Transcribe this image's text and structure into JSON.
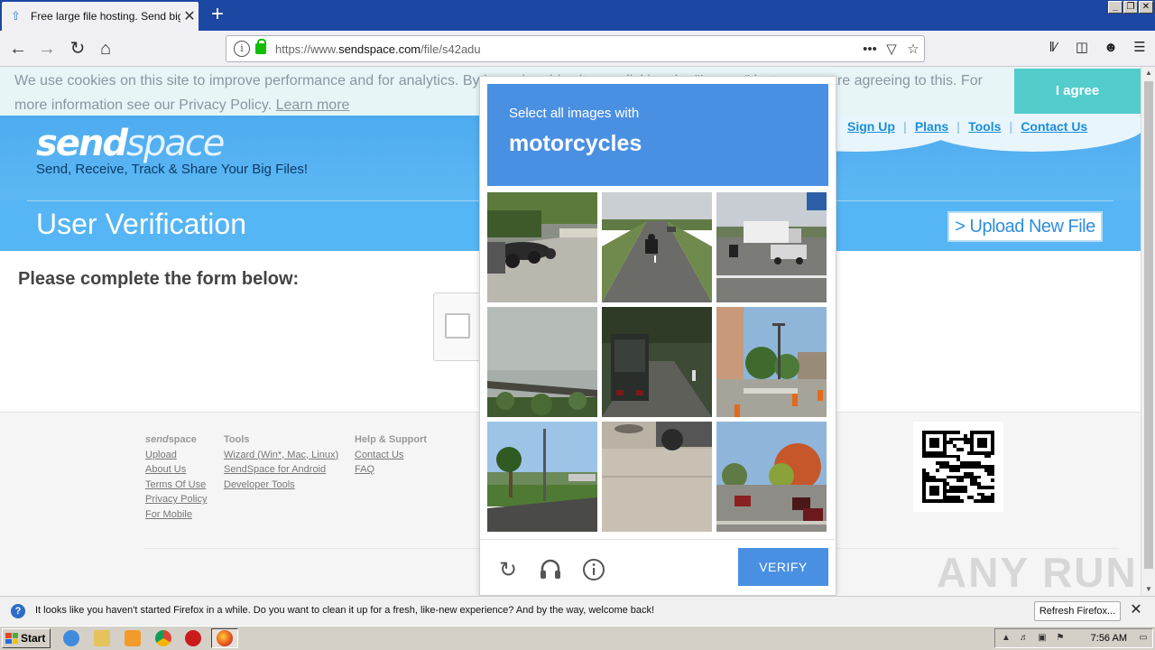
{
  "browser": {
    "tab_title": "Free large file hosting. Send big fil",
    "url_prefix": "https://www.",
    "url_domain": "sendspace.com",
    "url_path": "/file/s42adu"
  },
  "cookie_banner": {
    "text": "We use cookies on this site to improve performance and for analytics. By browsing this site, or clicking the \"I agree\" button, you are agreeing to this. For more information see our Privacy Policy.",
    "learn_more": "Learn more",
    "agree_label": "I agree"
  },
  "site": {
    "logo_bold": "send",
    "logo_light": "space",
    "tagline": "Send, Receive, Track & Share Your Big Files!",
    "nav": [
      "Sign Up",
      "Plans",
      "Tools",
      "Contact Us"
    ],
    "heading": "User Verification",
    "upload_label": "> Upload New File",
    "form_heading": "Please complete the form below:"
  },
  "captcha": {
    "prompt_line1": "Select all images with",
    "prompt_target": "motorcycles",
    "verify_label": "VERIFY",
    "tiles": [
      {
        "name": "tile-parked-motorcycles",
        "scene": "parked"
      },
      {
        "name": "tile-highway-rider",
        "scene": "highway"
      },
      {
        "name": "tile-truck-road",
        "scene": "truck"
      },
      {
        "name": "tile-guardrail-sky",
        "scene": "rail"
      },
      {
        "name": "tile-truck-rear",
        "scene": "rear"
      },
      {
        "name": "tile-street-corner",
        "scene": "corner"
      },
      {
        "name": "tile-palm-road",
        "scene": "palm"
      },
      {
        "name": "tile-pavement-drain",
        "scene": "drain"
      },
      {
        "name": "tile-residential-street",
        "scene": "residential"
      }
    ]
  },
  "footer": {
    "col1_brand_italic": "send",
    "col1_brand": "space",
    "col1_links": [
      "Upload",
      "About Us",
      "Terms Of Use",
      "Privacy Policy",
      "For Mobile"
    ],
    "col2_title": "Tools",
    "col2_links": [
      "Wizard (Win*, Mac, Linux)",
      "SendSpace for Android",
      "Developer Tools"
    ],
    "col3_title": "Help & Support",
    "col3_links": [
      "Contact Us",
      "FAQ"
    ],
    "watermark": "ANY RUN"
  },
  "notification": {
    "text": "It looks like you haven't started Firefox in a while. Do you want to clean it up for a fresh, like-new experience? And by the way, welcome back!",
    "button": "Refresh Firefox..."
  },
  "taskbar": {
    "start_label": "Start",
    "clock": "7:56 AM"
  }
}
